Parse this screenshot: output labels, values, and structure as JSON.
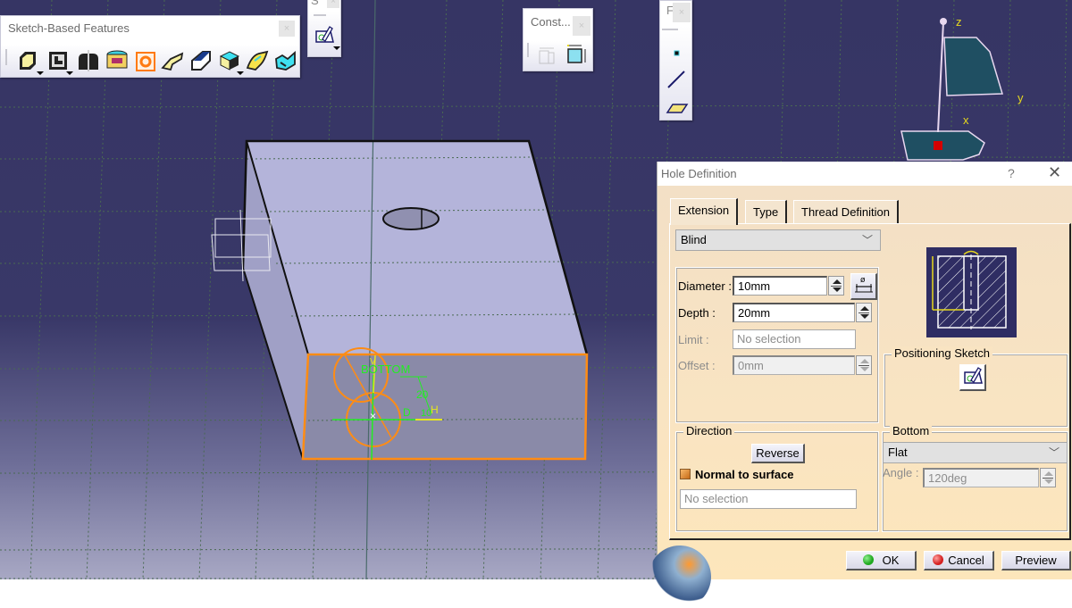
{
  "toolbars": {
    "sketch_based": {
      "title": "Sketch-Based Features",
      "close_icon": "close-icon",
      "icons": [
        "pad-icon",
        "pocket-icon",
        "shaft-icon",
        "groove-icon",
        "hole-icon",
        "rib-icon",
        "slot-icon",
        "stiffener-icon",
        "multi-sections-solid-icon",
        "removed-multi-sections-solid-icon"
      ]
    },
    "sketcher": {
      "title": "S",
      "icons": [
        "sketch-icon"
      ]
    },
    "constraints": {
      "title": "Const...",
      "icons": [
        "constraints-defined-in-dialog-icon",
        "constraint-icon"
      ]
    },
    "reference_elements": {
      "title": "F",
      "icons": [
        "point-icon",
        "line-icon",
        "plane-icon"
      ]
    }
  },
  "compass": {
    "axis_labels": {
      "z": "z",
      "y": "y",
      "x": "x"
    }
  },
  "sketch_annotations": {
    "face_label": "BOTTOM",
    "dimension_depth": "20",
    "dimension_diameter": "10",
    "axis_h": "H",
    "axis_v": "V",
    "dim_label_d": "D"
  },
  "dialog": {
    "title": "Hole Definition",
    "help_label": "?",
    "close_label": "✕",
    "tabs": [
      {
        "label": "Extension",
        "active": true
      },
      {
        "label": "Type",
        "active": false
      },
      {
        "label": "Thread Definition",
        "active": false
      }
    ],
    "extension_type": "Blind",
    "diameter": {
      "label": "Diameter :",
      "value": "10mm"
    },
    "depth": {
      "label": "Depth :",
      "value": "20mm"
    },
    "limit": {
      "label": "Limit :",
      "value": "No selection",
      "enabled": false
    },
    "offset": {
      "label": "Offset :",
      "value": "0mm",
      "enabled": false
    },
    "positioning_sketch": {
      "label": "Positioning Sketch"
    },
    "direction": {
      "label": "Direction",
      "reverse_label": "Reverse",
      "normal_to_surface_label": "Normal to surface",
      "normal_to_surface_checked": true,
      "selection": "No selection"
    },
    "bottom": {
      "label": "Bottom",
      "type": "Flat",
      "angle_label": "Angle :",
      "angle_value": "120deg",
      "angle_enabled": false
    },
    "buttons": {
      "ok": "OK",
      "cancel": "Cancel",
      "preview": "Preview"
    },
    "colors": {
      "ok_led": "#1fa81f",
      "cancel_led": "#d42020",
      "preview_bg": "#2f2d63"
    }
  }
}
